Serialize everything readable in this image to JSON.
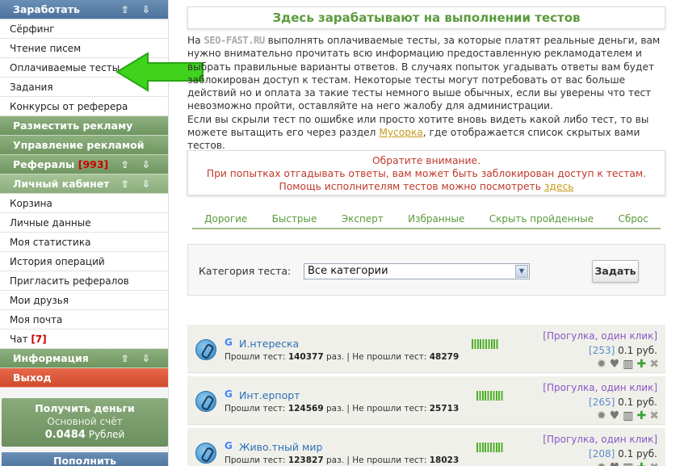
{
  "sidebar": {
    "earn": {
      "label": "Заработать",
      "arrows": "⇧ ⇩"
    },
    "earn_items": [
      "Сёрфинг",
      "Чтение писем",
      "Оплачиваемые тесты",
      "Задания",
      "Конкурсы от реферера"
    ],
    "place_ad": "Разместить рекламу",
    "manage_ad": "Управление рекламой",
    "referrals": {
      "label": "Рефералы",
      "badge": "[993]",
      "arrows": "⇧ ⇩"
    },
    "cabinet": {
      "label": "Личный кабинет",
      "arrows": "⇧ ⇩"
    },
    "cabinet_items": [
      "Корзина",
      "Личные данные",
      "Моя статистика",
      "История операций",
      "Пригласить рефералов",
      "Мои друзья",
      "Моя почта"
    ],
    "chat": {
      "label": "Чат",
      "badge": "[7]"
    },
    "info": {
      "label": "Информация",
      "arrows": "⇧ ⇩"
    },
    "exit": "Выход",
    "money": {
      "title": "Получить деньги",
      "account": "Основной счёт",
      "balance": "0.0484",
      "currency": "Рублей"
    },
    "topup": "Пополнить"
  },
  "main": {
    "title": "Здесь зарабатывают на выполнении тестов",
    "intro": {
      "p1_pre": "На ",
      "brand": "SEO-FAST.RU",
      "p1_post": " выполнять оплачиваемые тесты, за которые платят реальные деньги, вам нужно внимательно прочитать всю информацию предоставленную рекламодателем и выбрать правильные варианты ответов. В случаях попыток угадывать ответы вам будет заблокирован доступ к тестам. Некоторые тесты могут потребовать от вас больше действий но и оплата за такие тесты немного выше обычных, если вы уверены что тест невозможно пройти, оставляйте на него жалобу для администрации.",
      "p2_pre": "Если вы скрыли тест по ошибке или просто хотите вновь видеть какой либо тест, то вы можете вытащить его через раздел ",
      "p2_link": "Мусорка",
      "p2_post": ", где отображается список скрытых вами тестов."
    },
    "notice": {
      "line1": "Обратите внимание.",
      "line2": "При попытках отгадывать ответы, вам может быть заблокирован доступ к тестам.",
      "line3_pre": "Помощь исполнителям тестов можно посмотреть ",
      "line3_link": "здесь"
    },
    "filters": [
      "Дорогие",
      "Быстрые",
      "Эксперт",
      "Избранные",
      "Скрыть пройденные",
      "Сброс"
    ],
    "category": {
      "label": "Категория теста:",
      "selected": "Все категории",
      "button": "Задать"
    },
    "tests": [
      {
        "name": "И.нтереска",
        "passed_label": "Прошли тест:",
        "passed": "140377",
        "failed_label": "Не прошли тест:",
        "failed": "48279",
        "unit": "раз.",
        "type": "[Прогулка, один клик]",
        "count": "[253]",
        "price": "0.1 руб."
      },
      {
        "name": "Инт.ерпорт",
        "passed_label": "Прошли тест:",
        "passed": "124569",
        "failed_label": "Не прошли тест:",
        "failed": "25713",
        "unit": "раз.",
        "type": "[Прогулка, один клик]",
        "count": "[265]",
        "price": "0.1 руб."
      },
      {
        "name": "Живо.тный мир",
        "passed_label": "Прошли тест:",
        "passed": "123827",
        "failed_label": "Не прошли тест:",
        "failed": "18023",
        "unit": "раз.",
        "type": "[Прогулка, один клик]",
        "count": "[208]",
        "price": "0.1 руб."
      }
    ]
  },
  "colors": {
    "accent_green": "#5a9a3b",
    "notice_red": "#c0392b",
    "sidebar_blue": "#4d739c",
    "arrow_green": "#3fd31c"
  }
}
